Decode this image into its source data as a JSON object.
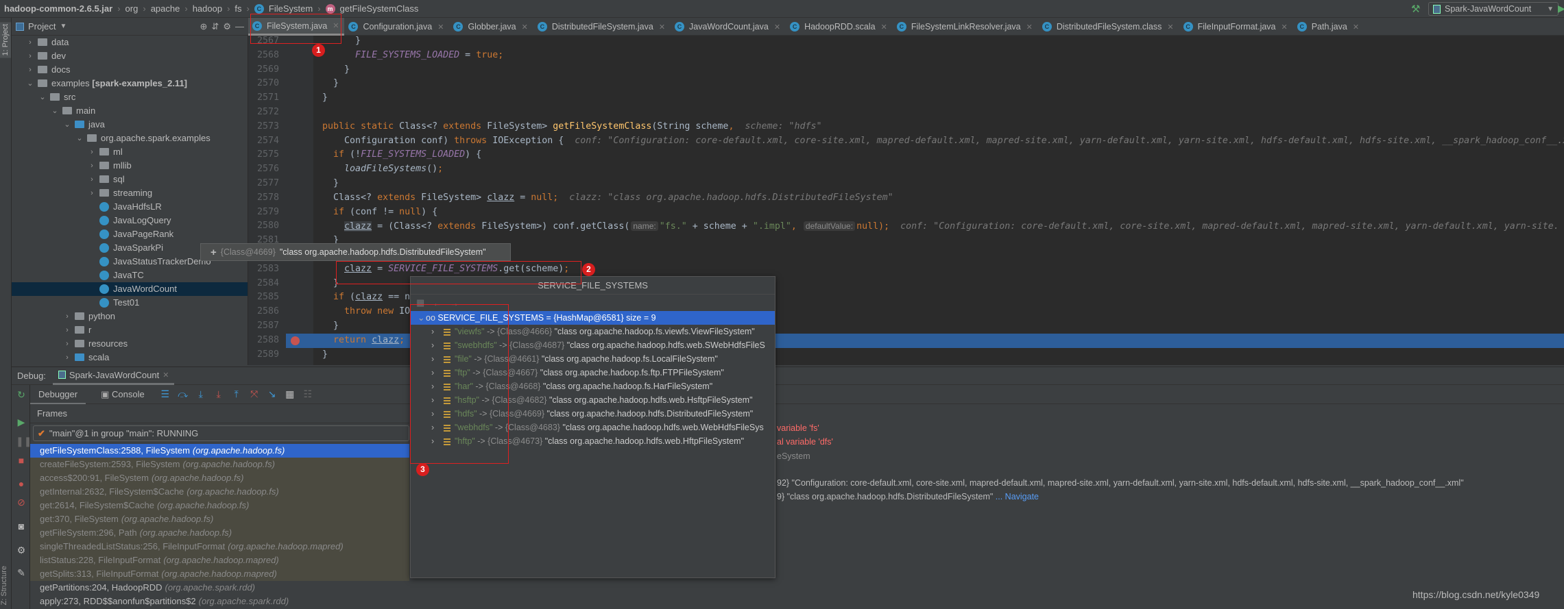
{
  "breadcrumb": {
    "items": [
      "hadoop-common-2.6.5.jar",
      "org",
      "apache",
      "hadoop",
      "fs",
      "FileSystem",
      "getFileSystemClass"
    ]
  },
  "run_config": {
    "label": "Spark-JavaWordCount"
  },
  "project_panel": {
    "side_label": "1: Project",
    "structure_label": "Z: Structure",
    "title": "Project",
    "tree": [
      {
        "label": "data",
        "depth": 0,
        "arrow": "›",
        "icon": "folder"
      },
      {
        "label": "dev",
        "depth": 0,
        "arrow": "›",
        "icon": "folder"
      },
      {
        "label": "docs",
        "depth": 0,
        "arrow": "›",
        "icon": "folder"
      },
      {
        "label": "examples",
        "module": " [spark-examples_2.11]",
        "depth": 0,
        "arrow": "⌄",
        "icon": "folder"
      },
      {
        "label": "src",
        "depth": 1,
        "arrow": "⌄",
        "icon": "folder"
      },
      {
        "label": "main",
        "depth": 2,
        "arrow": "⌄",
        "icon": "folder"
      },
      {
        "label": "java",
        "depth": 3,
        "arrow": "⌄",
        "icon": "source-folder"
      },
      {
        "label": "org.apache.spark.examples",
        "depth": 4,
        "arrow": "⌄",
        "icon": "package"
      },
      {
        "label": "ml",
        "depth": 5,
        "arrow": "›",
        "icon": "package"
      },
      {
        "label": "mllib",
        "depth": 5,
        "arrow": "›",
        "icon": "package"
      },
      {
        "label": "sql",
        "depth": 5,
        "arrow": "›",
        "icon": "package"
      },
      {
        "label": "streaming",
        "depth": 5,
        "arrow": "›",
        "icon": "package"
      },
      {
        "label": "JavaHdfsLR",
        "depth": 5,
        "arrow": "",
        "icon": "class"
      },
      {
        "label": "JavaLogQuery",
        "depth": 5,
        "arrow": "",
        "icon": "class"
      },
      {
        "label": "JavaPageRank",
        "depth": 5,
        "arrow": "",
        "icon": "class"
      },
      {
        "label": "JavaSparkPi",
        "depth": 5,
        "arrow": "",
        "icon": "class"
      },
      {
        "label": "JavaStatusTrackerDemo",
        "depth": 5,
        "arrow": "",
        "icon": "class"
      },
      {
        "label": "JavaTC",
        "depth": 5,
        "arrow": "",
        "icon": "class"
      },
      {
        "label": "JavaWordCount",
        "depth": 5,
        "arrow": "",
        "icon": "class",
        "selected": true
      },
      {
        "label": "Test01",
        "depth": 5,
        "arrow": "",
        "icon": "class"
      },
      {
        "label": "python",
        "depth": 3,
        "arrow": "›",
        "icon": "folder"
      },
      {
        "label": "r",
        "depth": 3,
        "arrow": "›",
        "icon": "folder"
      },
      {
        "label": "resources",
        "depth": 3,
        "arrow": "›",
        "icon": "resources-folder"
      },
      {
        "label": "scala",
        "depth": 3,
        "arrow": "›",
        "icon": "source-folder"
      }
    ]
  },
  "editor_tabs": [
    {
      "label": "FileSystem.java",
      "active": true
    },
    {
      "label": "Configuration.java"
    },
    {
      "label": "Globber.java"
    },
    {
      "label": "DistributedFileSystem.java"
    },
    {
      "label": "JavaWordCount.java"
    },
    {
      "label": "HadoopRDD.scala"
    },
    {
      "label": "FileSystemLinkResolver.java"
    },
    {
      "label": "DistributedFileSystem.class"
    },
    {
      "label": "FileInputFormat.java"
    },
    {
      "label": "Path.java"
    }
  ],
  "code": {
    "lines": [
      {
        "n": "2567",
        "tokens": [
          [
            "      }",
            "p"
          ]
        ]
      },
      {
        "n": "2568",
        "tokens": [
          [
            "      ",
            "p"
          ],
          [
            "FILE_SYSTEMS_LOADED",
            "const"
          ],
          [
            " = ",
            "p"
          ],
          [
            "true",
            "kw"
          ],
          [
            ";",
            "kw"
          ]
        ]
      },
      {
        "n": "2569",
        "tokens": [
          [
            "    }",
            "p"
          ]
        ]
      },
      {
        "n": "2570",
        "tokens": [
          [
            "  }",
            "p"
          ]
        ]
      },
      {
        "n": "2571",
        "tokens": [
          [
            "}",
            "p"
          ]
        ]
      },
      {
        "n": "2572",
        "tokens": []
      },
      {
        "n": "2573",
        "tokens": [
          [
            "public static ",
            "kw"
          ],
          [
            "Class<? ",
            "p"
          ],
          [
            "extends ",
            "kw"
          ],
          [
            "FileSystem> ",
            "p"
          ],
          [
            "getFileSystemClass",
            "fn"
          ],
          [
            "(String scheme",
            "p"
          ],
          [
            ",",
            "kw"
          ],
          [
            "  scheme: \"hdfs\"",
            "hint"
          ]
        ]
      },
      {
        "n": "2574",
        "tokens": [
          [
            "    Configuration conf) ",
            "p"
          ],
          [
            "throws ",
            "kw"
          ],
          [
            "IOException {",
            "p"
          ],
          [
            "  conf: \"Configuration: core-default.xml, core-site.xml, mapred-default.xml, mapred-site.xml, yarn-default.xml, yarn-site.xml, hdfs-default.xml, hdfs-site.xml, __spark_hadoop_conf__.x",
            "hint"
          ]
        ]
      },
      {
        "n": "2575",
        "tokens": [
          [
            "  ",
            "p"
          ],
          [
            "if ",
            "kw"
          ],
          [
            "(!",
            "p"
          ],
          [
            "FILE_SYSTEMS_LOADED",
            "const"
          ],
          [
            ") {",
            "p"
          ]
        ]
      },
      {
        "n": "2576",
        "tokens": [
          [
            "    ",
            "p"
          ],
          [
            "loadFileSystems",
            "static"
          ],
          [
            "()",
            "p"
          ],
          [
            ";",
            "kw"
          ]
        ]
      },
      {
        "n": "2577",
        "tokens": [
          [
            "  }",
            "p"
          ]
        ]
      },
      {
        "n": "2578",
        "tokens": [
          [
            "  Class<? ",
            "p"
          ],
          [
            "extends ",
            "kw"
          ],
          [
            "FileSystem> ",
            "p"
          ],
          [
            "clazz",
            "var"
          ],
          [
            " = ",
            "p"
          ],
          [
            "null",
            "kw"
          ],
          [
            ";",
            "kw"
          ],
          [
            "  clazz: \"class org.apache.hadoop.hdfs.DistributedFileSystem\"",
            "hint"
          ]
        ]
      },
      {
        "n": "2579",
        "tokens": [
          [
            "  ",
            "p"
          ],
          [
            "if ",
            "kw"
          ],
          [
            "(conf != ",
            "p"
          ],
          [
            "null",
            "kw"
          ],
          [
            ") {",
            "p"
          ]
        ]
      },
      {
        "n": "2580",
        "tokens": [
          [
            "    ",
            "p"
          ],
          [
            "clazz",
            "var t-hl"
          ],
          [
            " = (Class<? ",
            "p"
          ],
          [
            "extends ",
            "kw"
          ],
          [
            "FileSystem>) conf.getClass(",
            "p"
          ],
          [
            "name:",
            "phint"
          ],
          [
            "\"fs.\"",
            "str"
          ],
          [
            " + scheme + ",
            "p"
          ],
          [
            "\".impl\"",
            "str"
          ],
          [
            ",",
            "kw"
          ],
          [
            " ",
            "p"
          ],
          [
            "defaultValue:",
            "phint"
          ],
          [
            "null",
            "kw"
          ],
          [
            ");",
            "kw"
          ],
          [
            "  conf: \"Configuration: core-default.xml, core-site.xml, mapred-default.xml, mapred-site.xml, yarn-default.xml, yarn-site.",
            "hint"
          ]
        ]
      },
      {
        "n": "2581",
        "tokens": [
          [
            "  }",
            "p"
          ]
        ]
      },
      {
        "n": "2582",
        "tokens": []
      },
      {
        "n": "2583",
        "tokens": [
          [
            "    ",
            "p"
          ],
          [
            "clazz",
            "var"
          ],
          [
            " = ",
            "p"
          ],
          [
            "SERVICE_FILE_SYSTEMS",
            "const"
          ],
          [
            ".get(scheme)",
            "p"
          ],
          [
            ";",
            "kw"
          ]
        ]
      },
      {
        "n": "2584",
        "tokens": [
          [
            "  }",
            "p"
          ]
        ]
      },
      {
        "n": "2585",
        "tokens": [
          [
            "  ",
            "p"
          ],
          [
            "if ",
            "kw"
          ],
          [
            "(",
            "p"
          ],
          [
            "clazz",
            "var"
          ],
          [
            " == n",
            "p"
          ]
        ]
      },
      {
        "n": "2586",
        "tokens": [
          [
            "    ",
            "p"
          ],
          [
            "throw new ",
            "kw"
          ],
          [
            "IO",
            "p"
          ]
        ]
      },
      {
        "n": "2587",
        "tokens": [
          [
            "  }",
            "p"
          ]
        ]
      },
      {
        "n": "2588",
        "tokens": [
          [
            "  ",
            "p"
          ],
          [
            "return ",
            "kw"
          ],
          [
            "clazz",
            "var"
          ],
          [
            ";",
            "kw"
          ]
        ],
        "execution_point": true,
        "breakpoint": true
      },
      {
        "n": "2589",
        "tokens": [
          [
            "}",
            "p"
          ]
        ]
      }
    ]
  },
  "tooltip": {
    "ref": "{Class@4669}",
    "value": "\"class org.apache.hadoop.hdfs.DistributedFileSystem\""
  },
  "popup": {
    "title": "SERVICE_FILE_SYSTEMS",
    "root": {
      "name": "SERVICE_FILE_SYSTEMS",
      "ref": " = {HashMap@6581}",
      "extra": "  size = 9"
    },
    "entries": [
      {
        "key": "\"viewfs\"",
        "ref": "{Class@4666}",
        "value": "\"class org.apache.hadoop.fs.viewfs.ViewFileSystem\""
      },
      {
        "key": "\"swebhdfs\"",
        "ref": "{Class@4687}",
        "value": "\"class org.apache.hadoop.hdfs.web.SWebHdfsFileS"
      },
      {
        "key": "\"file\"",
        "ref": "{Class@4661}",
        "value": "\"class org.apache.hadoop.fs.LocalFileSystem\""
      },
      {
        "key": "\"ftp\"",
        "ref": "{Class@4667}",
        "value": "\"class org.apache.hadoop.fs.ftp.FTPFileSystem\""
      },
      {
        "key": "\"har\"",
        "ref": "{Class@4668}",
        "value": "\"class org.apache.hadoop.fs.HarFileSystem\""
      },
      {
        "key": "\"hsftp\"",
        "ref": "{Class@4682}",
        "value": "\"class org.apache.hadoop.hdfs.web.HsftpFileSystem\""
      },
      {
        "key": "\"hdfs\"",
        "ref": "{Class@4669}",
        "value": "\"class org.apache.hadoop.hdfs.DistributedFileSystem\""
      },
      {
        "key": "\"webhdfs\"",
        "ref": "{Class@4683}",
        "value": "\"class org.apache.hadoop.hdfs.web.WebHdfsFileSys"
      },
      {
        "key": "\"hftp\"",
        "ref": "{Class@4673}",
        "value": "\"class org.apache.hadoop.hdfs.web.HftpFileSystem\""
      }
    ],
    "arrow_sep": " -> "
  },
  "debug": {
    "label": "Debug:",
    "session_tab": "Spark-JavaWordCount",
    "tabs": {
      "debugger": "Debugger",
      "console": "Console"
    },
    "frames_label": "Frames",
    "thread": "\"main\"@1 in group \"main\": RUNNING",
    "frames": [
      {
        "method": "getFileSystemClass:2588, FileSystem",
        "pkg": "(org.apache.hadoop.fs)",
        "state": "sel"
      },
      {
        "method": "createFileSystem:2593, FileSystem",
        "pkg": "(org.apache.hadoop.fs)",
        "state": "lib"
      },
      {
        "method": "access$200:91, FileSystem",
        "pkg": "(org.apache.hadoop.fs)",
        "state": "lib"
      },
      {
        "method": "getInternal:2632, FileSystem$Cache",
        "pkg": "(org.apache.hadoop.fs)",
        "state": "lib"
      },
      {
        "method": "get:2614, FileSystem$Cache",
        "pkg": "(org.apache.hadoop.fs)",
        "state": "lib"
      },
      {
        "method": "get:370, FileSystem",
        "pkg": "(org.apache.hadoop.fs)",
        "state": "lib"
      },
      {
        "method": "getFileSystem:296, Path",
        "pkg": "(org.apache.hadoop.fs)",
        "state": "lib"
      },
      {
        "method": "singleThreadedListStatus:256, FileInputFormat",
        "pkg": "(org.apache.hadoop.mapred)",
        "state": "lib"
      },
      {
        "method": "listStatus:228, FileInputFormat",
        "pkg": "(org.apache.hadoop.mapred)",
        "state": "lib"
      },
      {
        "method": "getSplits:313, FileInputFormat",
        "pkg": "(org.apache.hadoop.mapred)",
        "state": "lib"
      },
      {
        "method": "getPartitions:204, HadoopRDD",
        "pkg": "(org.apache.spark.rdd)",
        "state": ""
      },
      {
        "method": "apply:273, RDD$$anonfun$partitions$2",
        "pkg": "(org.apache.spark.rdd)",
        "state": ""
      }
    ]
  },
  "variables_visible": {
    "l1": "variable 'fs'",
    "l2": "al variable 'dfs'",
    "l3": "eSystem",
    "l4": "92} \"Configuration: core-default.xml, core-site.xml, mapred-default.xml, mapred-site.xml, yarn-default.xml, yarn-site.xml, hdfs-default.xml, hdfs-site.xml, __spark_hadoop_conf__.xml\"",
    "l5": "9} \"class org.apache.hadoop.hdfs.DistributedFileSystem\"",
    "navigate": "... Navigate"
  },
  "annotations": {
    "a1": "1",
    "a2": "2",
    "a3": "3"
  },
  "watermark": "https://blog.csdn.net/kyle0349",
  "colors": {
    "selection": "#2f65ca",
    "execution_line": "#2d5e9a",
    "annotation_red": "#e02020",
    "keyword": "#cc7832",
    "constant": "#9876aa",
    "string": "#6a8759"
  }
}
